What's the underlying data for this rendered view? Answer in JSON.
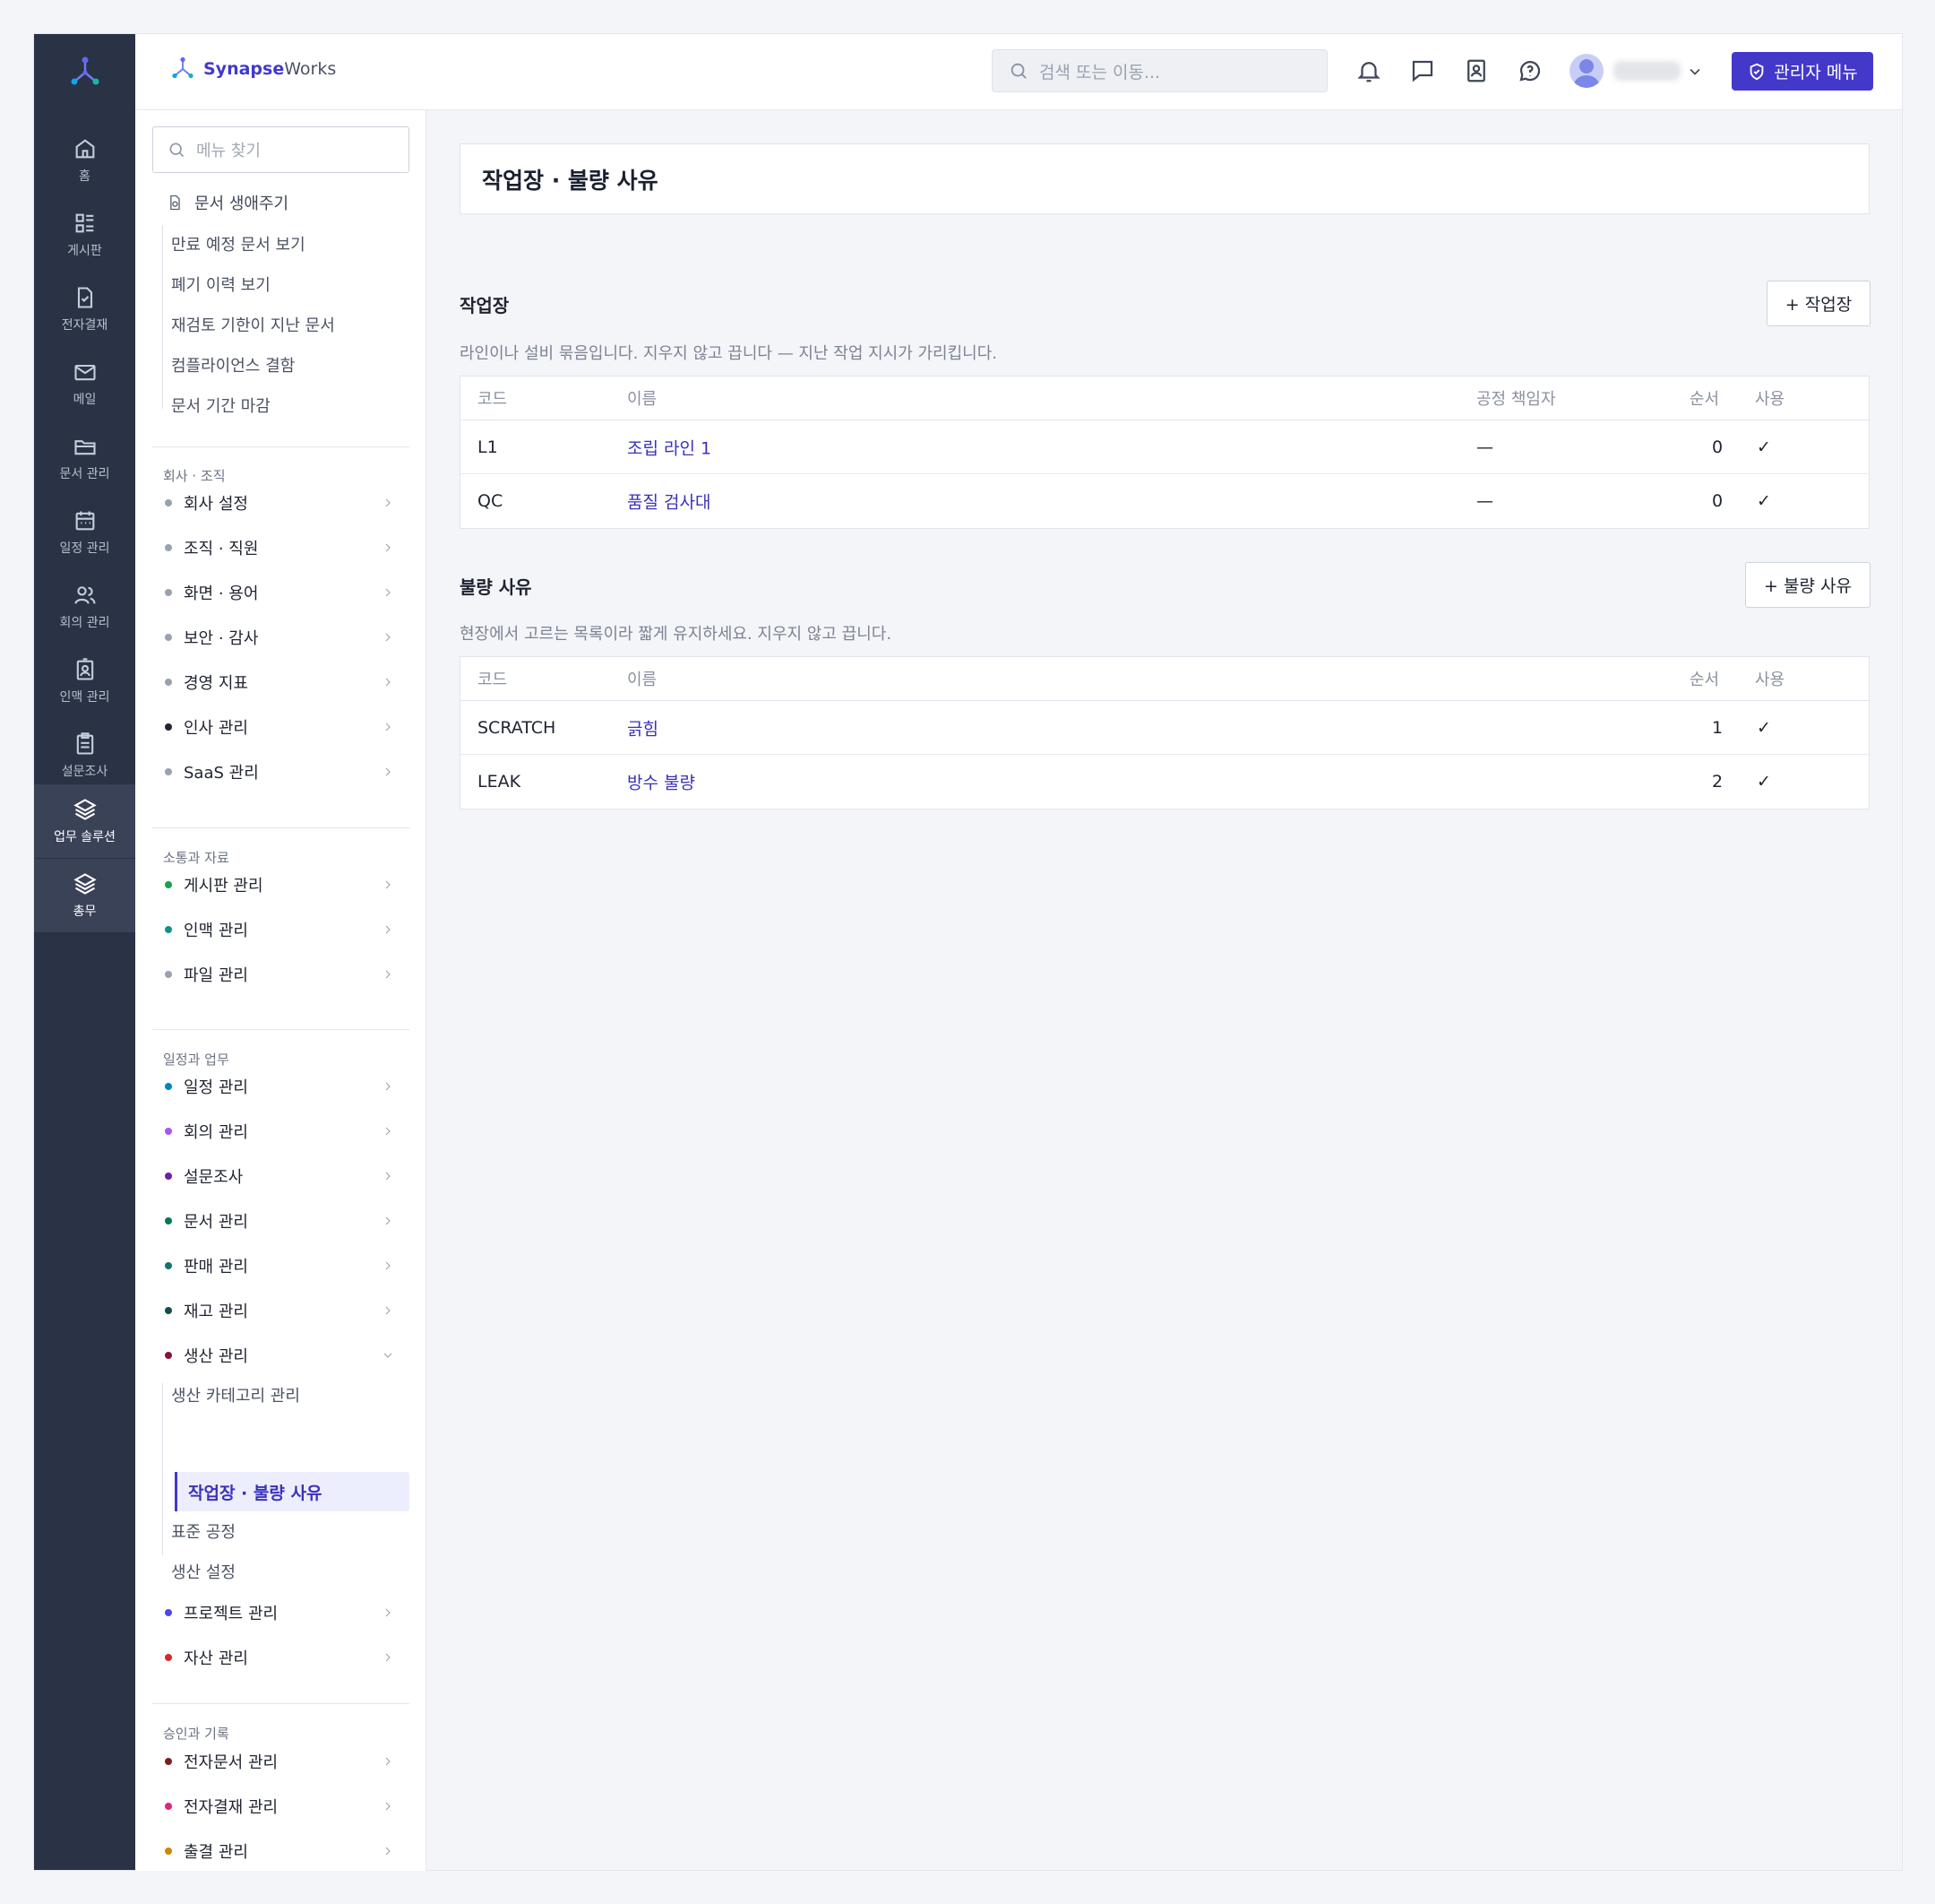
{
  "rail": {
    "items": [
      {
        "label": "홈",
        "icon": "home-icon"
      },
      {
        "label": "게시판",
        "icon": "board-icon"
      },
      {
        "label": "전자결재",
        "icon": "approval-icon"
      },
      {
        "label": "메일",
        "icon": "mail-icon"
      },
      {
        "label": "문서 관리",
        "icon": "folder-icon"
      },
      {
        "label": "일정 관리",
        "icon": "calendar-icon"
      },
      {
        "label": "회의 관리",
        "icon": "people-icon"
      },
      {
        "label": "인맥 관리",
        "icon": "contact-icon"
      },
      {
        "label": "설문조사",
        "icon": "survey-icon"
      },
      {
        "label": "업무 솔루션",
        "icon": "layers-icon"
      },
      {
        "label": "총무",
        "icon": "layers-icon"
      }
    ]
  },
  "topbar": {
    "brand_bold": "Synapse",
    "brand_rest": "Works",
    "search_placeholder": "검색 또는 이동...",
    "admin_label": "관리자 메뉴"
  },
  "menu": {
    "search_placeholder": "메뉴 찾기",
    "doc_lifecycle": {
      "label": "문서 생애주기",
      "subs": [
        "만료 예정 문서 보기",
        "폐기 이력 보기",
        "재검토 기한이 지난 문서",
        "컴플라이언스 결함",
        "문서 기간 마감"
      ]
    },
    "sections": [
      {
        "label": "회사 · 조직",
        "items": [
          {
            "label": "회사 설정",
            "color": "#9aa1ae"
          },
          {
            "label": "조직 · 직원",
            "color": "#9aa1ae"
          },
          {
            "label": "화면 · 용어",
            "color": "#9aa1ae"
          },
          {
            "label": "보안 · 감사",
            "color": "#9aa1ae"
          },
          {
            "label": "경영 지표",
            "color": "#9aa1ae"
          },
          {
            "label": "인사 관리",
            "color": "#1f2430"
          },
          {
            "label": "SaaS 관리",
            "color": "#9aa1ae"
          }
        ]
      },
      {
        "label": "소통과 자료",
        "items": [
          {
            "label": "게시판 관리",
            "color": "#16a34a"
          },
          {
            "label": "인맥 관리",
            "color": "#0d9488"
          },
          {
            "label": "파일 관리",
            "color": "#9aa1ae"
          }
        ]
      },
      {
        "label": "일정과 업무",
        "items": [
          {
            "label": "일정 관리",
            "color": "#0284c7"
          },
          {
            "label": "회의 관리",
            "color": "#a855f7"
          },
          {
            "label": "설문조사",
            "color": "#6b21a8"
          },
          {
            "label": "문서 관리",
            "color": "#047857"
          },
          {
            "label": "판매 관리",
            "color": "#0f766e"
          },
          {
            "label": "재고 관리",
            "color": "#134e4a"
          },
          {
            "label": "생산 관리",
            "color": "#881337"
          }
        ],
        "production_subs": [
          "생산 카테고리 관리",
          "작업장 · 불량 사유",
          "표준 공정",
          "생산 설정"
        ],
        "after_items": [
          {
            "label": "프로젝트 관리",
            "color": "#4f46e5"
          },
          {
            "label": "자산 관리",
            "color": "#dc2626"
          }
        ]
      },
      {
        "label": "승인과 기록",
        "items": [
          {
            "label": "전자문서 관리",
            "color": "#7f1d1d"
          },
          {
            "label": "전자결재 관리",
            "color": "#db2777"
          },
          {
            "label": "출결 관리",
            "color": "#ca8a04"
          }
        ]
      }
    ]
  },
  "main": {
    "page_title": "작업장 · 불량 사유",
    "workcenters": {
      "title": "작업장",
      "add_label": "+ 작업장",
      "desc": "라인이나 설비 묶음입니다. 지우지 않고 끕니다 — 지난 작업 지시가 가리킵니다.",
      "headers": {
        "code": "코드",
        "name": "이름",
        "manager": "공정 책임자",
        "order": "순서",
        "use": "사용"
      },
      "rows": [
        {
          "code": "L1",
          "name": "조립 라인 1",
          "manager": "—",
          "order": "0",
          "use": "✓"
        },
        {
          "code": "QC",
          "name": "품질 검사대",
          "manager": "—",
          "order": "0",
          "use": "✓"
        }
      ]
    },
    "defects": {
      "title": "불량 사유",
      "add_label": "+ 불량 사유",
      "desc": "현장에서 고르는 목록이라 짧게 유지하세요. 지우지 않고 끕니다.",
      "headers": {
        "code": "코드",
        "name": "이름",
        "order": "순서",
        "use": "사용"
      },
      "rows": [
        {
          "code": "SCRATCH",
          "name": "긁힘",
          "order": "1",
          "use": "✓"
        },
        {
          "code": "LEAK",
          "name": "방수 불량",
          "order": "2",
          "use": "✓"
        }
      ]
    }
  }
}
